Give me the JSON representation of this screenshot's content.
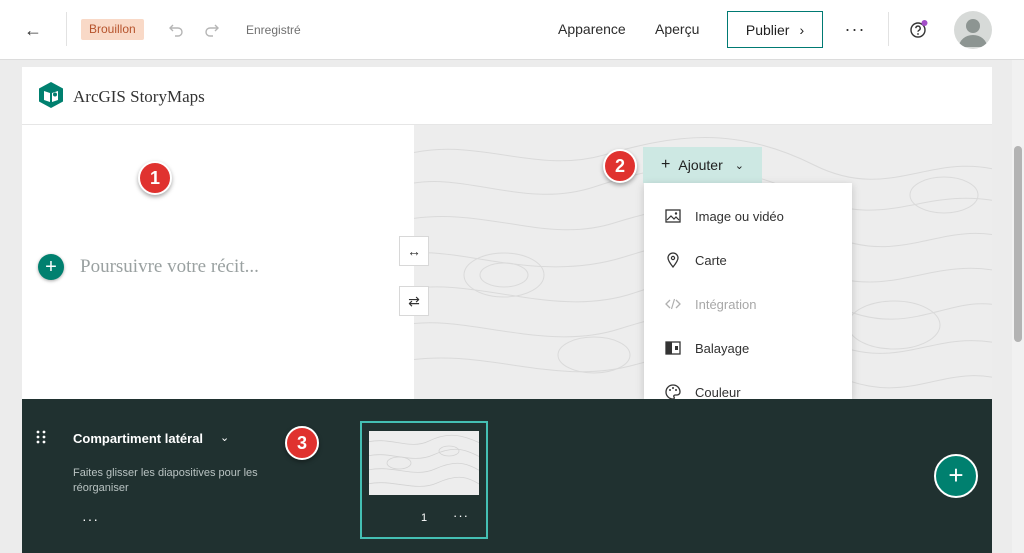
{
  "toolbar": {
    "status": "Brouillon",
    "saved": "Enregistré",
    "appearance": "Apparence",
    "preview": "Aperçu",
    "publish": "Publier",
    "more": "···"
  },
  "story": {
    "brand": "ArcGIS StoryMaps",
    "continue_placeholder": "Poursuivre votre récit...",
    "add_button": "Ajouter",
    "add_menu": [
      {
        "label": "Image ou vidéo",
        "icon": "image-icon",
        "disabled": false
      },
      {
        "label": "Carte",
        "icon": "map-pin-icon",
        "disabled": false
      },
      {
        "label": "Intégration",
        "icon": "code-icon",
        "disabled": true
      },
      {
        "label": "Balayage",
        "icon": "swipe-icon",
        "disabled": false
      },
      {
        "label": "Couleur",
        "icon": "palette-icon",
        "disabled": false
      }
    ]
  },
  "markers": [
    "1",
    "2",
    "3"
  ],
  "sidecar": {
    "title": "Compartiment latéral",
    "hint": "Faites glisser les diapositives pour les réorganiser",
    "more": "···",
    "slide_number": "1",
    "slide_more": "···"
  },
  "colors": {
    "accent": "#00806f",
    "draft_bg": "#f9d9c7",
    "draft_text": "#b6532c",
    "add_button_bg": "#cde8e3",
    "dark_panel": "#203130",
    "marker": "#e0322f",
    "selection": "#44bfb3"
  }
}
